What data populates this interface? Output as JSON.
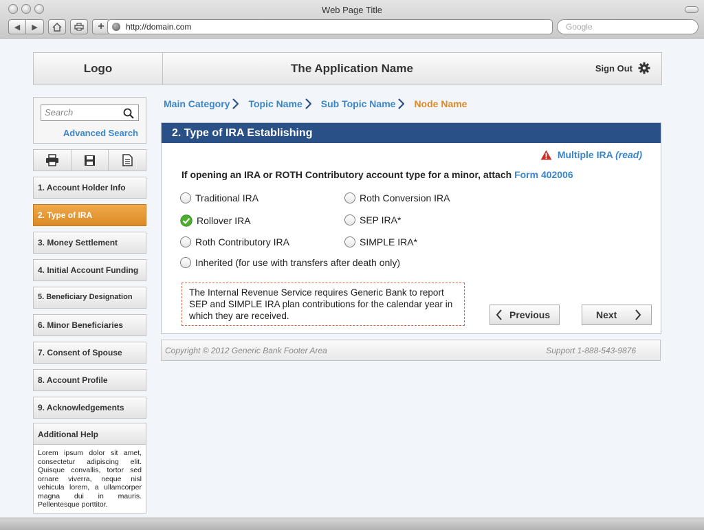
{
  "browser": {
    "window_title": "Web Page Title",
    "url": "http://domain.com",
    "search_placeholder": "Google"
  },
  "header": {
    "logo": "Logo",
    "app_name": "The Application Name",
    "sign_out": "Sign Out"
  },
  "sidebar": {
    "search_placeholder": "Search",
    "advanced_search": "Advanced Search",
    "tools": [
      "print-icon",
      "save-icon",
      "document-icon"
    ],
    "steps": [
      "1. Account Holder Info",
      "2. Type of IRA",
      "3. Money Settlement",
      "4. Initial Account Funding",
      "5. Beneficiary Designation",
      "6. Minor Beneficiaries",
      "7. Consent of Spouse",
      "8. Account Profile",
      "9. Acknowledgements"
    ],
    "active_step": 1,
    "help_title": "Additional Help",
    "help_text": "Lorem ipsum dolor sit amet, consectetur adipiscing elit. Quisque convallis, tortor sed ornare viverra, neque nisl vehicula lorem, a ullamcorper magna dui in mauris. Pellentesque porttitor."
  },
  "breadcrumb": {
    "items": [
      "Main Category",
      "Topic Name",
      "Sub Topic Name"
    ],
    "current": "Node Name"
  },
  "form": {
    "title": "2. Type of IRA Establishing",
    "warning_label": "Multiple IRA",
    "warning_suffix": "(read)",
    "question": "If opening an IRA or ROTH Contributory account type for a minor, attach ",
    "question_link": "Form 402006",
    "options": [
      {
        "label": "Traditional IRA",
        "selected": false
      },
      {
        "label": "Roth Conversion IRA",
        "selected": false
      },
      {
        "label": "Rollover IRA",
        "selected": true
      },
      {
        "label": "SEP IRA*",
        "selected": false
      },
      {
        "label": "Roth Contributory IRA",
        "selected": false
      },
      {
        "label": "SIMPLE IRA*",
        "selected": false
      },
      {
        "label": "Inherited (for use with transfers after death only)",
        "selected": false
      }
    ],
    "notice": "The Internal Revenue Service requires Generic Bank to report SEP and SIMPLE IRA plan contributions for the calendar year in which they are received.",
    "previous": "Previous",
    "next": "Next"
  },
  "footer": {
    "copyright": "Copyright © 2012 Generic Bank Footer Area",
    "support": "Support 1-888-543-9876"
  },
  "colors": {
    "accent_blue": "#3a86c8",
    "panel_header": "#2a5187",
    "active_orange": "#dc8a26",
    "selected_green": "#4caf2e",
    "warning_red": "#c8302a"
  }
}
